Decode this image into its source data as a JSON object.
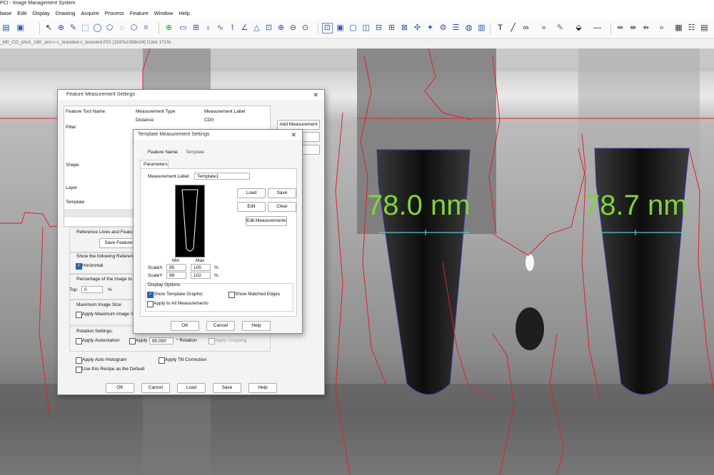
{
  "window": {
    "title": "PCI - Image Management System"
  },
  "menu": [
    "base",
    "Edit",
    "Display",
    "Drawing",
    "Acquire",
    "Process",
    "Feature",
    "Window",
    "Help"
  ],
  "path": "_M0_CG_pitch_18K_ann-r-c_branded-c_branded.PCI [1920x1569x24] Color 171%",
  "measurements": [
    "78.0 nm",
    "78.7 nm"
  ],
  "colors": {
    "measure": "#7fd43b",
    "edges": "#e0202a",
    "accent": "#2a5fb8"
  },
  "fms": {
    "title": "Feature Measurement Settings",
    "headers": [
      "Feature Tool Name",
      "Measurement Type",
      "Measurement Label"
    ],
    "rows": [
      {
        "name": "",
        "type": "Distance",
        "label": "CD0"
      },
      {
        "name": "Pillar",
        "type": "",
        "label": ""
      },
      {
        "name": "Shape",
        "type": "",
        "label": ""
      },
      {
        "name": "Layer",
        "type": "",
        "label": ""
      },
      {
        "name": "Template",
        "type": "",
        "label": ""
      }
    ],
    "add_measurement": "Add Measurement",
    "ref_lines": "Reference Lines and Feature S",
    "save_feature": "Save Feature St",
    "show_refs": "Show the following References",
    "horizontal": "Horizontal",
    "pct_ignore": "Percentage of the image to igno",
    "top_label": "Top:",
    "top_value": "0",
    "pct": "%",
    "max_size_label": "Maximum Image Size:",
    "apply_max": "Apply Maximum Image Size",
    "rotation_label": "Rotation Settings:",
    "apply_autorotation": "Apply Autorotation",
    "apply": "Apply",
    "rotation_value": "90.000",
    "rotation_unit": "° Rotation",
    "apply_cropping": "Apply Cropping",
    "apply_auto_hist": "Apply Auto Histogram",
    "apply_tilt": "Apply Tilt Correction",
    "use_default": "Use this Recipe as the Default",
    "ok": "OK",
    "cancel": "Cancel",
    "load": "Load",
    "save": "Save",
    "help": "Help"
  },
  "tms": {
    "title": "Template Measurement Settings",
    "feature_name_label": "Feature Name:",
    "feature_name_value": "Template",
    "tab": "Parameters",
    "meas_label": "Measurement Label:",
    "meas_value": "Template1",
    "load": "Load",
    "save": "Save",
    "edit": "Edit",
    "clear": "Clear",
    "edit_measurements": "Edit Measurements",
    "min": "Min",
    "max": "Max",
    "scalex": "ScaleX",
    "scalex_min": "95",
    "scalex_max": "105",
    "scaley": "ScaleY",
    "scaley_min": "98",
    "scaley_max": "102",
    "pct": "%",
    "display_options": "Display Options",
    "show_template": "Show Template Graphic",
    "show_matched": "Show Matched Edges",
    "apply_all": "Apply to All Measurements",
    "ok": "OK",
    "cancel": "Cancel",
    "help": "Help"
  }
}
